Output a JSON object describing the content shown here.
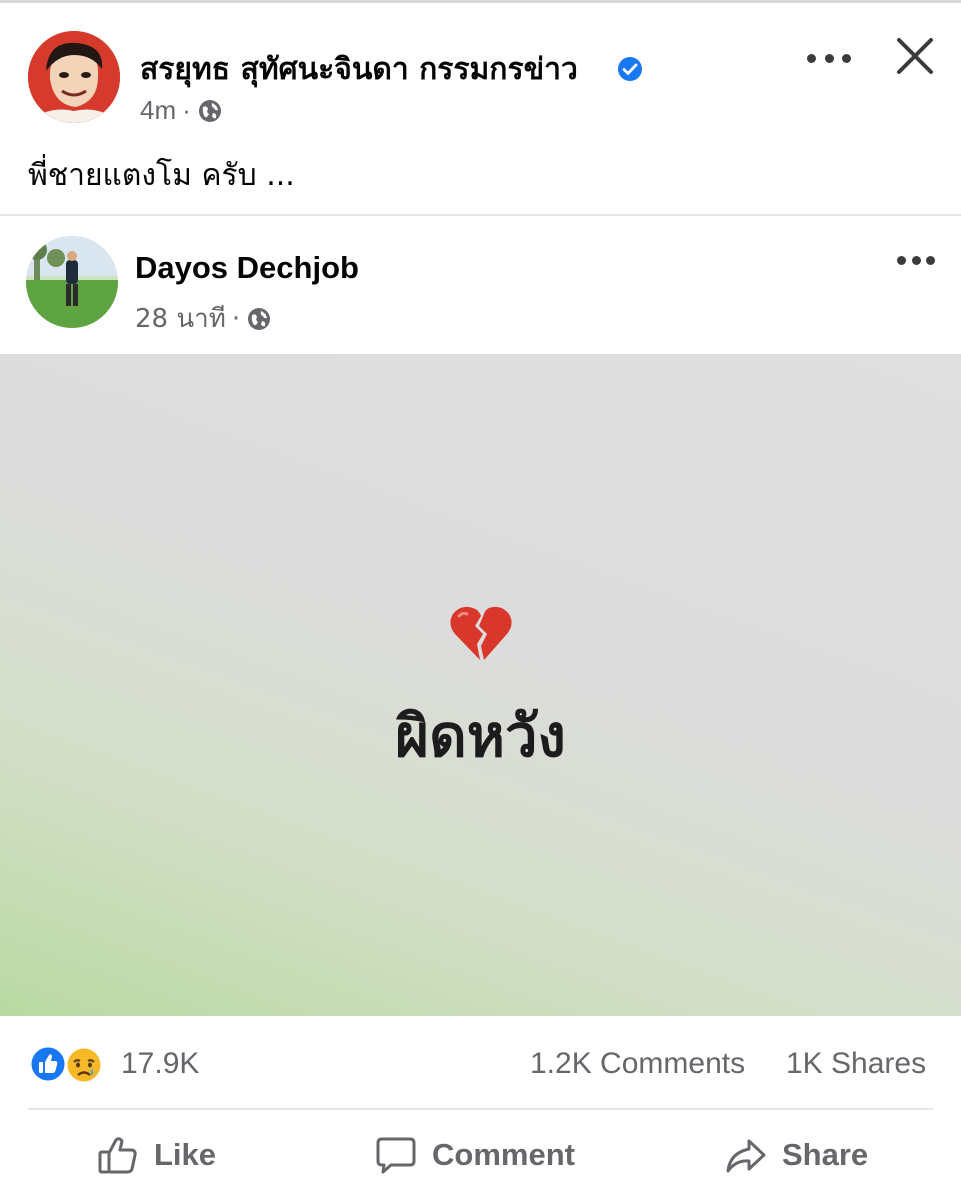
{
  "post": {
    "author": "สรยุทธ สุทัศนะจินดา กรรมกรข่าว",
    "time": "4m",
    "separator": "·",
    "caption": "พี่ชายแตงโม ครับ ..."
  },
  "shared_post": {
    "author": "Dayos Dechjob",
    "time": "28 นาที",
    "separator": "·",
    "text": "ผิดหวัง",
    "emoji": "broken-heart"
  },
  "reactions": {
    "count": "17.9K",
    "comments": "1.2K Comments",
    "shares": "1K Shares",
    "types": [
      "like",
      "sad"
    ]
  },
  "actions": {
    "like": "Like",
    "comment": "Comment",
    "share": "Share"
  },
  "icons": {
    "verified": "verified-badge-icon",
    "privacy": "globe-icon",
    "more": "more-horizontal-icon",
    "close": "close-icon"
  },
  "colors": {
    "verified": "#1877f2",
    "like": "#1877f2",
    "sad": "#f7b928",
    "secondary_text": "#65676b"
  }
}
